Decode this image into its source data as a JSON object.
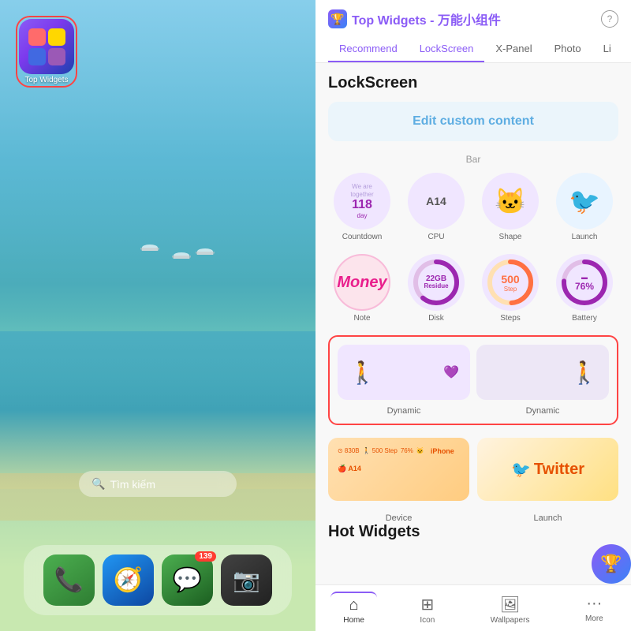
{
  "left": {
    "app_icon_label": "Top Widgets",
    "search_placeholder": "Tìm kiếm",
    "dock": {
      "icons": [
        {
          "name": "phone",
          "symbol": "📞",
          "badge": null
        },
        {
          "name": "safari",
          "symbol": "🧭",
          "badge": null
        },
        {
          "name": "messages",
          "symbol": "💬",
          "badge": "139"
        },
        {
          "name": "camera",
          "symbol": "📷",
          "badge": null
        }
      ]
    }
  },
  "right": {
    "header": {
      "title": "Top Widgets - 万能小组件",
      "help_label": "?"
    },
    "nav_tabs": [
      {
        "label": "Recommend",
        "active": false
      },
      {
        "label": "LockScreen",
        "active": true
      },
      {
        "label": "X-Panel",
        "active": false
      },
      {
        "label": "Photo",
        "active": false
      },
      {
        "label": "Li",
        "active": false
      }
    ],
    "section_lockscreen": "LockScreen",
    "edit_button": "Edit custom content",
    "bar_label": "Bar",
    "widgets_row1": [
      {
        "label": "Countdown",
        "type": "countdown",
        "top_text": "We are together",
        "main": "118",
        "sub": "day"
      },
      {
        "label": "CPU",
        "type": "cpu",
        "main": "A14"
      },
      {
        "label": "Shape",
        "type": "shape"
      },
      {
        "label": "Launch",
        "type": "launch"
      }
    ],
    "widgets_row2": [
      {
        "label": "Note",
        "type": "note",
        "main": "Money"
      },
      {
        "label": "Disk",
        "type": "disk",
        "main": "22GB",
        "sub": "Residue"
      },
      {
        "label": "Steps",
        "type": "steps",
        "main": "500",
        "sub": "Step"
      },
      {
        "label": "Battery",
        "type": "battery",
        "main": "76%"
      }
    ],
    "dynamic_labels": [
      "Dynamic",
      "Dynamic"
    ],
    "preview_items": [
      {
        "label": "Device",
        "type": "device"
      },
      {
        "label": "Launch",
        "type": "twitter"
      }
    ],
    "twitter_text": "Twitter",
    "hot_widgets_title": "Hot Widgets",
    "bottom_nav": [
      {
        "label": "Home",
        "icon": "⌂",
        "active": true
      },
      {
        "label": "Icon",
        "icon": "⊞",
        "active": false
      },
      {
        "label": "Wallpapers",
        "icon": "🖼",
        "active": false
      },
      {
        "label": "More",
        "icon": "···",
        "active": false
      }
    ]
  }
}
